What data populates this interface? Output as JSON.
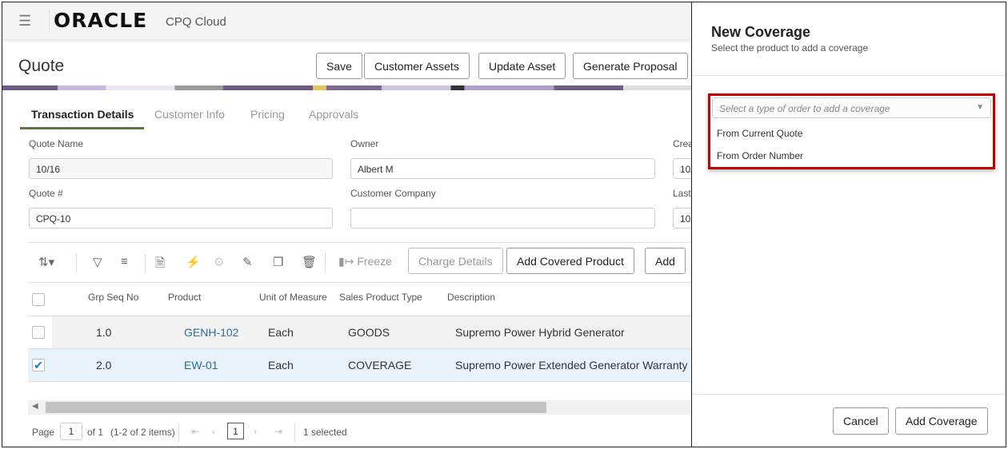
{
  "header": {
    "brand": "ORACLE",
    "product": "CPQ Cloud"
  },
  "page": {
    "title": "Quote",
    "buttons": [
      "Save",
      "Customer Assets",
      "Update Asset",
      "Generate Proposal"
    ]
  },
  "tabs": [
    "Transaction Details",
    "Customer Info",
    "Pricing",
    "Approvals"
  ],
  "form": {
    "quote_name_label": "Quote Name",
    "quote_name": "10/16",
    "owner_label": "Owner",
    "owner": "Albert M",
    "created_label": "Crea",
    "created": "10/",
    "quote_num_label": "Quote #",
    "quote_num": "CPQ-10",
    "company_label": "Customer Company",
    "company": "",
    "last_label": "Last",
    "last": "10/"
  },
  "toolbar": {
    "freeze": "Freeze",
    "charge_details": "Charge Details",
    "add_covered": "Add Covered Product",
    "add": "Add"
  },
  "table": {
    "headers": [
      "Grp Seq No",
      "Product",
      "Unit of Measure",
      "Sales Product Type",
      "Description"
    ],
    "rows": [
      {
        "seq": "1.0",
        "product": "GENH-102",
        "uom": "Each",
        "type": "GOODS",
        "desc": "Supremo Power Hybrid Generator",
        "checked": false
      },
      {
        "seq": "2.0",
        "product": "EW-01",
        "uom": "Each",
        "type": "COVERAGE",
        "desc": "Supremo Power Extended Generator Warranty",
        "checked": true
      }
    ]
  },
  "pager": {
    "page_label": "Page",
    "page": "1",
    "of": "of 1",
    "items": "(1-2 of 2 items)",
    "current": "1",
    "selected": "1 selected"
  },
  "panel": {
    "title": "New Coverage",
    "subtitle": "Select the product to add a coverage",
    "placeholder": "Select a type of order to add a coverage",
    "options": [
      "From Current Quote",
      "From Order Number"
    ],
    "cancel": "Cancel",
    "add": "Add Coverage"
  },
  "colors": {
    "accent_tab": "#5b7a3e",
    "link": "#2b6aa4",
    "highlight": "#c00000",
    "selected_row": "#e8f2fa"
  }
}
